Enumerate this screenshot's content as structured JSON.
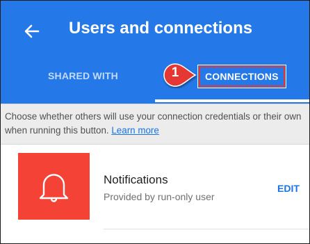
{
  "header": {
    "title": "Users and connections",
    "back_icon": "arrow-left-icon",
    "color": "#2478e8"
  },
  "tabs": [
    {
      "label": "SHARED WITH",
      "selected": false
    },
    {
      "label": "CONNECTIONS",
      "selected": true
    }
  ],
  "callout": {
    "number": "1",
    "color": "#e53935"
  },
  "info": {
    "text": "Choose whether others will use your connection credentials or their own when running this button. ",
    "link": "Learn more"
  },
  "connection": {
    "icon": "bell-icon",
    "icon_bg": "#f44336",
    "title": "Notifications",
    "subtitle": "Provided by run-only user",
    "action_label": "EDIT"
  }
}
